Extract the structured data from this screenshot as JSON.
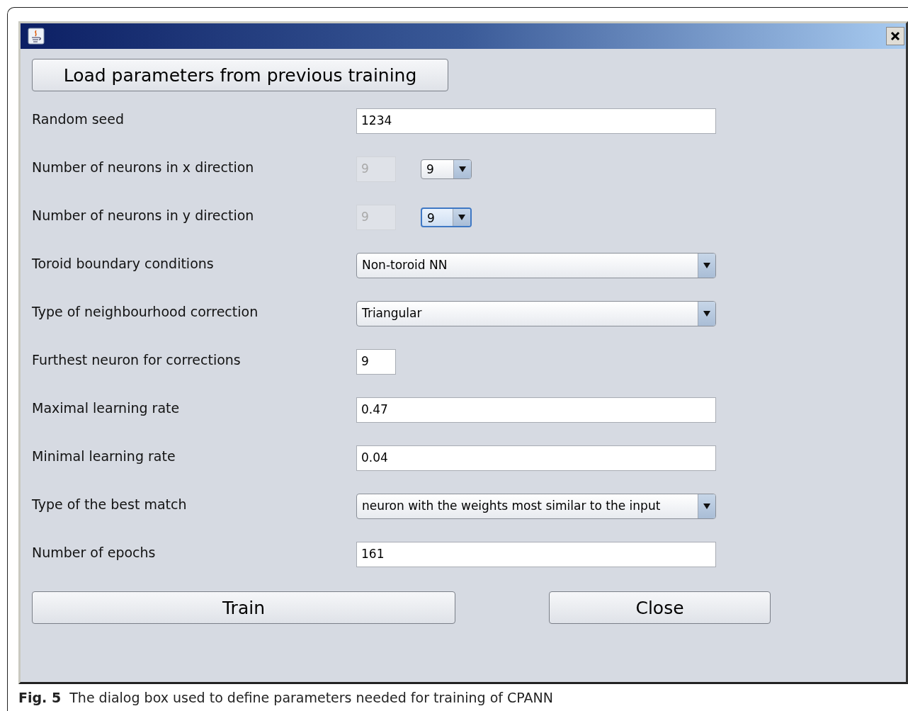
{
  "load_button": "Load parameters from previous training",
  "rows": [
    {
      "kind": "text",
      "label": "Random seed",
      "value": "1234"
    },
    {
      "kind": "pair",
      "label": "Number of neurons in x direction",
      "value": "9",
      "disabled": true,
      "choice": "9",
      "focused": false
    },
    {
      "kind": "pair",
      "label": "Number of neurons in y direction",
      "value": "9",
      "disabled": true,
      "choice": "9",
      "focused": true
    },
    {
      "kind": "combo",
      "label": "Toroid boundary conditions",
      "value": "Non-toroid NN"
    },
    {
      "kind": "combo",
      "label": "Type of neighbourhood correction",
      "value": "Triangular"
    },
    {
      "kind": "short",
      "label": "Furthest neuron for corrections",
      "value": "9"
    },
    {
      "kind": "text",
      "label": "Maximal learning rate",
      "value": "0.47"
    },
    {
      "kind": "text",
      "label": "Minimal learning rate",
      "value": "0.04"
    },
    {
      "kind": "combo",
      "label": "Type of the best match",
      "value": "neuron with the weights most similar to the input"
    },
    {
      "kind": "text",
      "label": "Number of epochs",
      "value": "161"
    }
  ],
  "buttons": [
    {
      "kind": "train",
      "label": "Train"
    },
    {
      "kind": "close",
      "label": "Close"
    }
  ],
  "caption": {
    "number": "Fig. 5",
    "text": "The dialog box used to define parameters needed for training of CPANN"
  }
}
